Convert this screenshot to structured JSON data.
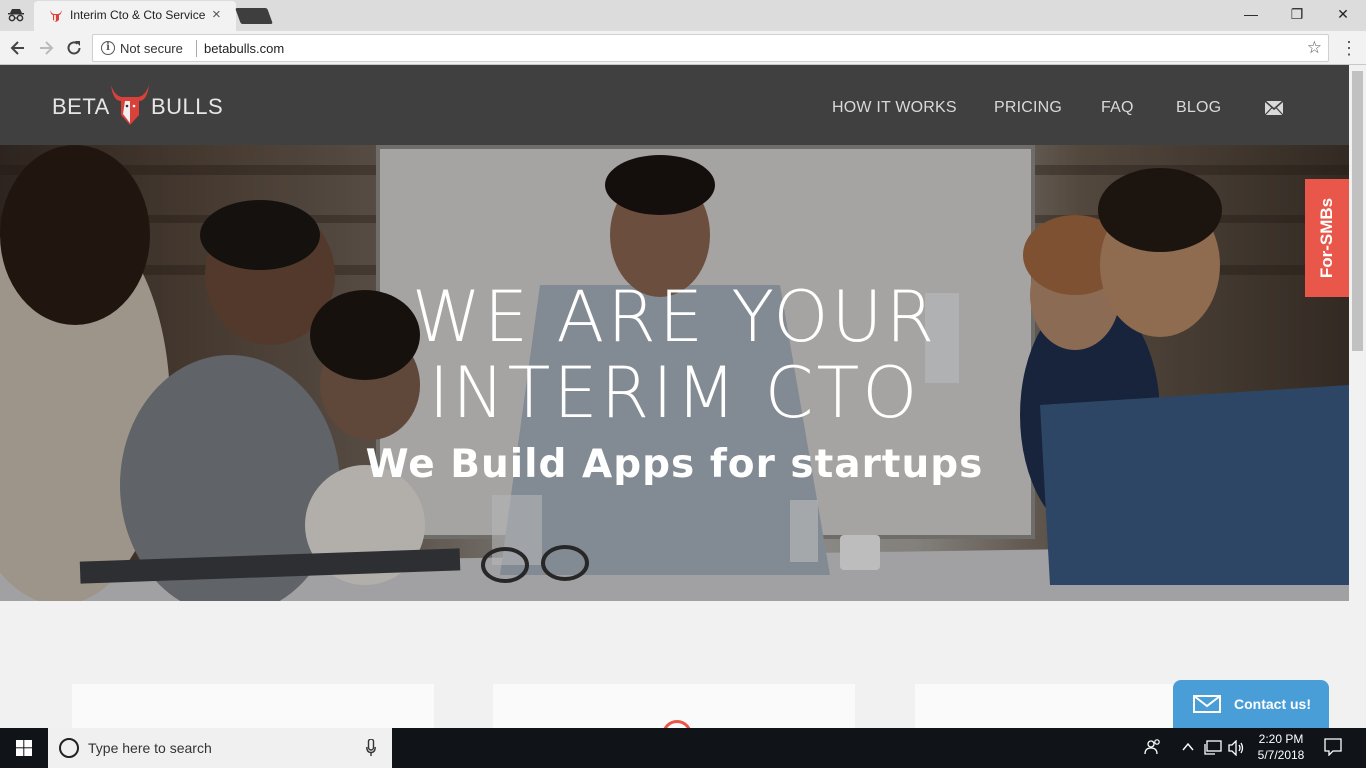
{
  "browser": {
    "tab_title": "Interim Cto & Cto Services",
    "tab_close": "×",
    "security_label": "Not secure",
    "url": "betabulls.com",
    "window_buttons": {
      "minimize": "—",
      "maximize": "❐",
      "close": "✕"
    }
  },
  "site": {
    "logo": {
      "left": "BETA",
      "right": "BULLS"
    },
    "nav": [
      "HOW IT WORKS",
      "PRICING",
      "FAQ",
      "BLOG"
    ],
    "hero": {
      "line1": "WE ARE YOUR",
      "line2": "INTERIM CTO",
      "subtitle": "We Build Apps for startups"
    },
    "side_tab": "For-SMBs",
    "contact_button": "Contact us!"
  },
  "taskbar": {
    "search_placeholder": "Type here to search",
    "time": "2:20 PM",
    "date": "5/7/2018"
  },
  "colors": {
    "header_bg": "#404040",
    "accent_red": "#e9574a",
    "contact_blue": "#4a9ed8",
    "page_bg": "#f1f1f1"
  }
}
